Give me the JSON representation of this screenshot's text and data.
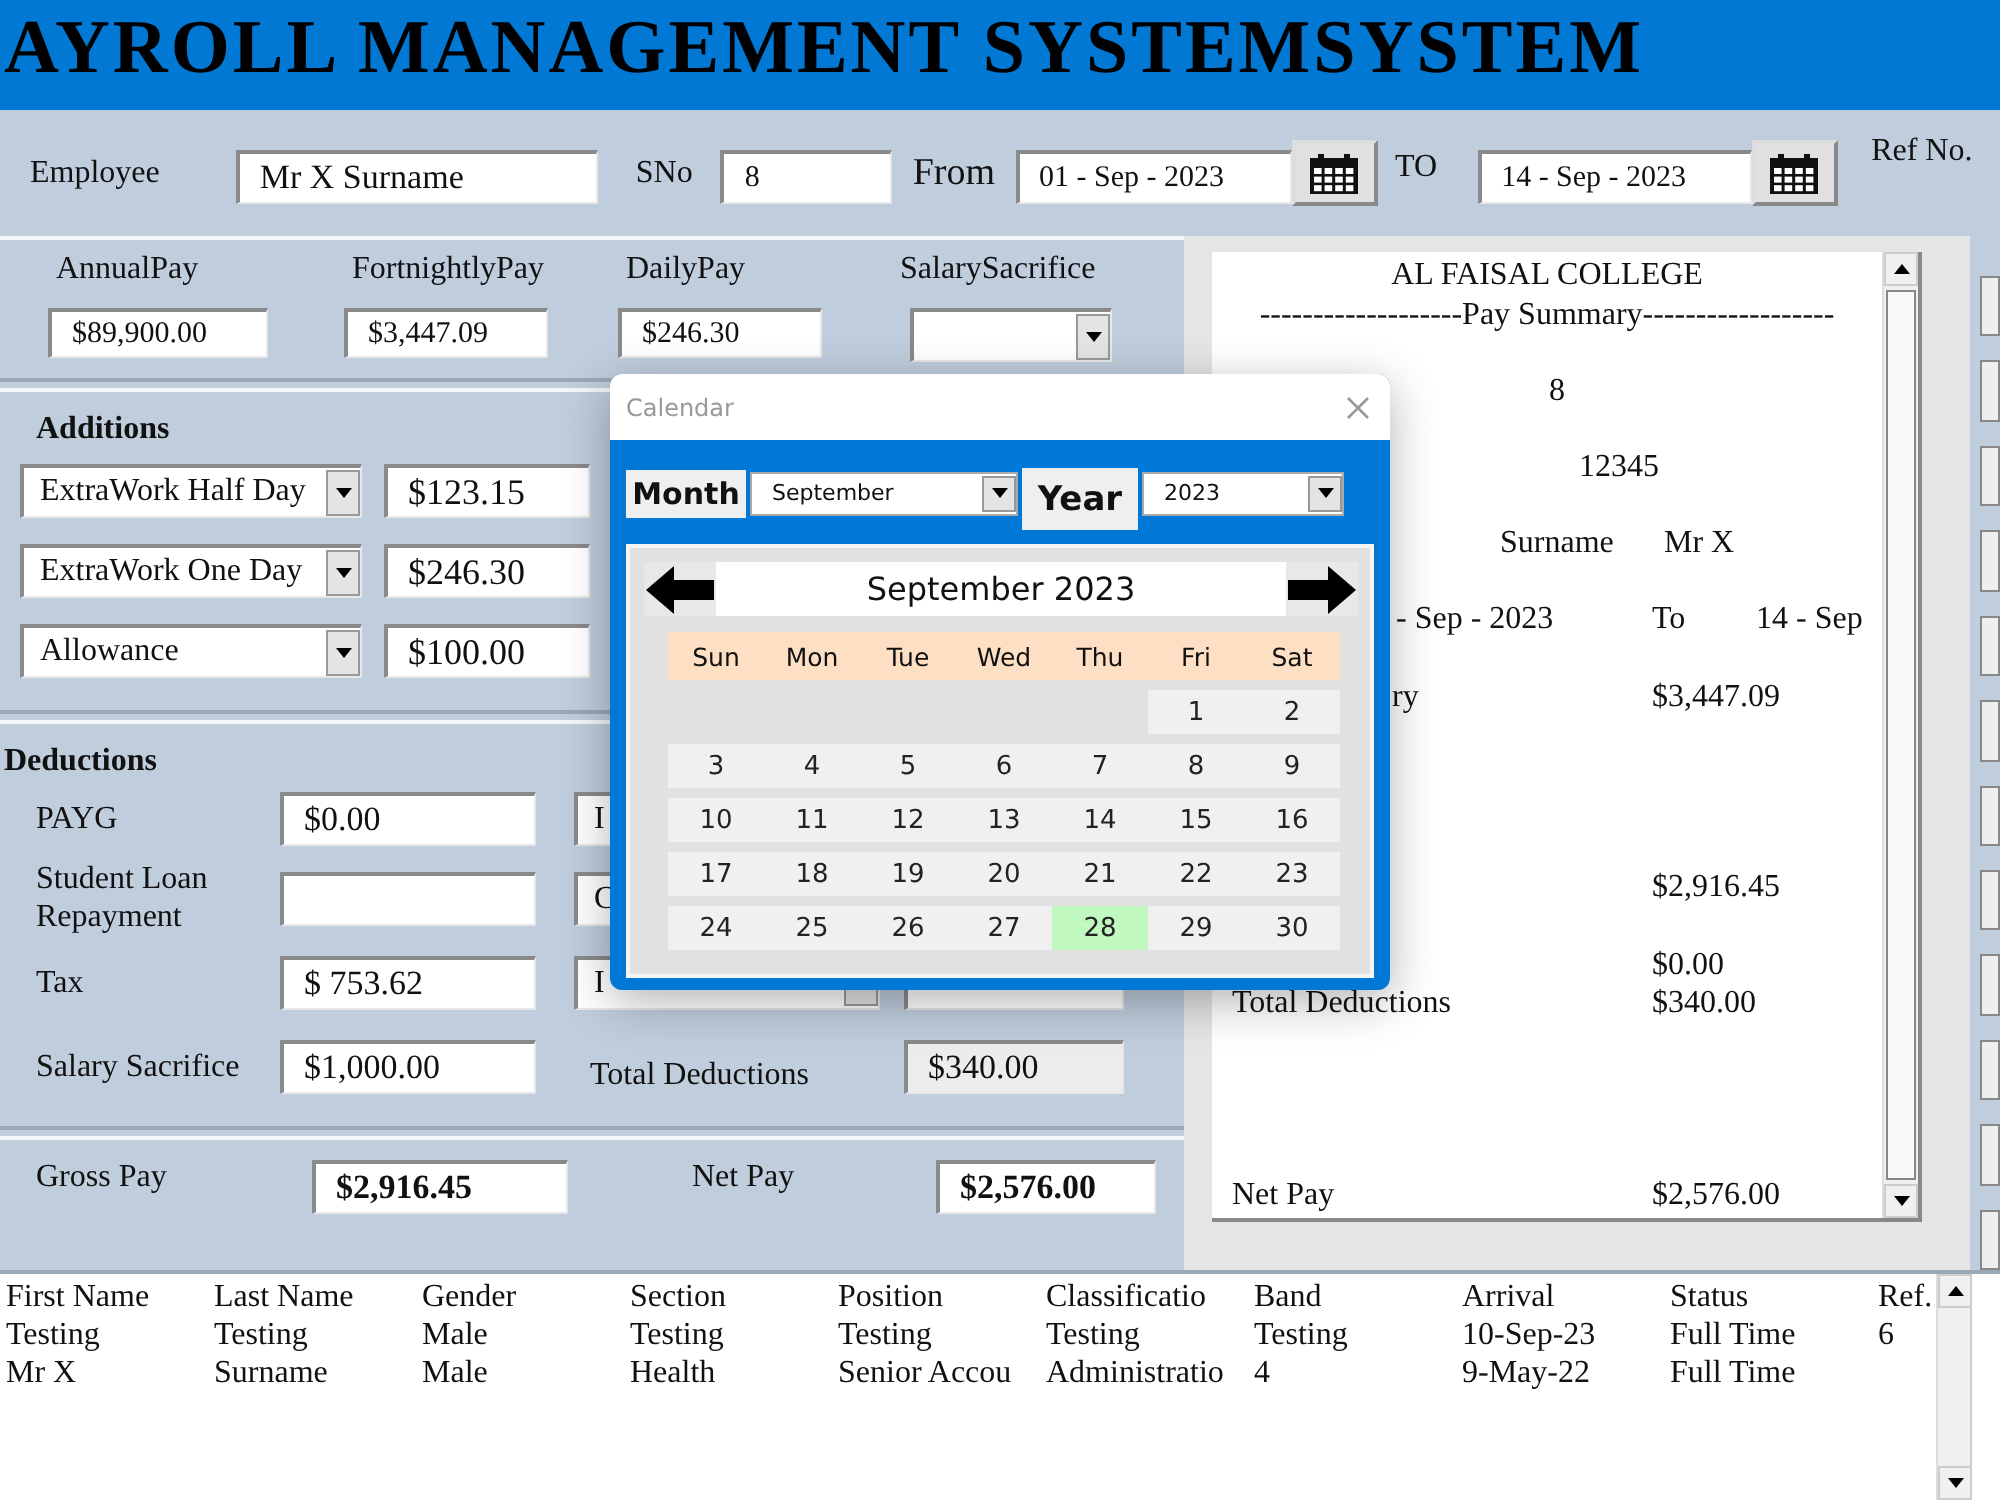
{
  "app_title": "AYROLL MANAGEMENT SYSTEMSYSTEM",
  "employee_bar": {
    "employee_label": "Employee",
    "employee": "Mr X Surname",
    "sno_label": "SNo",
    "sno": "8",
    "from_label": "From",
    "from": "01 - Sep - 2023",
    "to_label": "TO",
    "to": "14 - Sep - 2023",
    "ref_label": "Ref  No."
  },
  "pay": [
    {
      "kind": "text",
      "label": "AnnualPay",
      "value": "$89,900.00"
    },
    {
      "kind": "text",
      "label": "FortnightlyPay",
      "value": "$3,447.09"
    },
    {
      "kind": "text",
      "label": "DailyPay",
      "value": "$246.30"
    },
    {
      "kind": "select",
      "label": "SalarySacrifice"
    }
  ],
  "additions": {
    "title": "Additions",
    "rows": [
      {
        "item": "ExtraWork Half Day",
        "amount": "$123.15"
      },
      {
        "item": "ExtraWork One Day",
        "amount": "$246.30"
      },
      {
        "item": "Allowance",
        "amount": "$100.00"
      }
    ]
  },
  "deductions": {
    "title": "Deductions",
    "rows": [
      {
        "label": "PAYG",
        "value": "$0.00",
        "option": "I"
      },
      {
        "label": "Student Loan Repayment",
        "option": "C"
      },
      {
        "label": "Tax",
        "value": "$ 753.62",
        "option": "I"
      },
      {
        "label": "Salary Sacrifice",
        "value": "$1,000.00"
      }
    ],
    "total": {
      "label": "Total Deductions",
      "value": "$340.00"
    }
  },
  "gross": {
    "label": "Gross Pay",
    "value": "$2,916.45"
  },
  "net": {
    "label": "Net Pay",
    "value": "$2,576.00"
  },
  "summary": {
    "title": "AL FAISAL COLLEGE",
    "subtitle": "-------------------Pay Summary------------------",
    "lines": [
      {
        "kind": "center",
        "text": "8"
      },
      {
        "kind": "center-right",
        "text": "12345"
      },
      {
        "kind": "name",
        "label": "Surname",
        "value": "Mr X"
      },
      {
        "kind": "period",
        "from": "- Sep - 2023",
        "to_label": "To",
        "to": "14 - Sep"
      },
      {
        "kind": "amount",
        "label": "ry",
        "value": "$3,447.09"
      },
      {
        "kind": "amount-far",
        "value": "$2,916.45"
      },
      {
        "kind": "amount-near",
        "value": "$0.00"
      },
      {
        "kind": "amount-tight",
        "label": "Total Deductions",
        "value": "$340.00"
      },
      {
        "kind": "bottom",
        "label": "Net Pay",
        "value": "$2,576.00"
      }
    ]
  },
  "table": {
    "columns": [
      "First Name",
      "Last Name",
      "Gender",
      "Section",
      "Position",
      "Classificatio",
      "Band",
      "Arrival",
      "Status",
      "Ref."
    ],
    "rows": [
      [
        "Testing",
        "Testing",
        "Male",
        "Testing",
        "Testing",
        "Testing",
        "Testing",
        "10-Sep-23",
        "Full Time",
        "6"
      ],
      [
        "Mr X",
        "Surname",
        "Male",
        "Health",
        "Senior Accou",
        "Administratio",
        "4",
        "9-May-22",
        "Full Time"
      ]
    ]
  },
  "calendar_dialog": {
    "title": "Calendar",
    "month_label": "Month",
    "month": "September",
    "year_label": "Year",
    "year": "2023",
    "heading": "September 2023",
    "weekdays": [
      "Sun",
      "Mon",
      "Tue",
      "Wed",
      "Thu",
      "Fri",
      "Sat"
    ],
    "days": [
      {
        "kind": "blank"
      },
      {
        "kind": "blank"
      },
      {
        "kind": "blank"
      },
      {
        "kind": "blank"
      },
      {
        "kind": "blank"
      },
      {
        "kind": "day",
        "label": "1",
        "selected": false
      },
      {
        "kind": "day",
        "label": "2",
        "selected": false
      },
      {
        "kind": "day",
        "label": "3",
        "selected": false
      },
      {
        "kind": "day",
        "label": "4",
        "selected": false
      },
      {
        "kind": "day",
        "label": "5",
        "selected": false
      },
      {
        "kind": "day",
        "label": "6",
        "selected": false
      },
      {
        "kind": "day",
        "label": "7",
        "selected": false
      },
      {
        "kind": "day",
        "label": "8",
        "selected": false
      },
      {
        "kind": "day",
        "label": "9",
        "selected": false
      },
      {
        "kind": "day",
        "label": "10",
        "selected": false
      },
      {
        "kind": "day",
        "label": "11",
        "selected": false
      },
      {
        "kind": "day",
        "label": "12",
        "selected": false
      },
      {
        "kind": "day",
        "label": "13",
        "selected": false
      },
      {
        "kind": "day",
        "label": "14",
        "selected": false
      },
      {
        "kind": "day",
        "label": "15",
        "selected": false
      },
      {
        "kind": "day",
        "label": "16",
        "selected": false
      },
      {
        "kind": "day",
        "label": "17",
        "selected": false
      },
      {
        "kind": "day",
        "label": "18",
        "selected": false
      },
      {
        "kind": "day",
        "label": "19",
        "selected": false
      },
      {
        "kind": "day",
        "label": "20",
        "selected": false
      },
      {
        "kind": "day",
        "label": "21",
        "selected": false
      },
      {
        "kind": "day",
        "label": "22",
        "selected": false
      },
      {
        "kind": "day",
        "label": "23",
        "selected": false
      },
      {
        "kind": "day",
        "label": "24",
        "selected": false
      },
      {
        "kind": "day",
        "label": "25",
        "selected": false
      },
      {
        "kind": "day",
        "label": "26",
        "selected": false
      },
      {
        "kind": "day",
        "label": "27",
        "selected": false
      },
      {
        "kind": "day",
        "label": "28",
        "selected": true
      },
      {
        "kind": "day",
        "label": "29",
        "selected": false
      },
      {
        "kind": "day",
        "label": "30",
        "selected": false
      }
    ]
  }
}
